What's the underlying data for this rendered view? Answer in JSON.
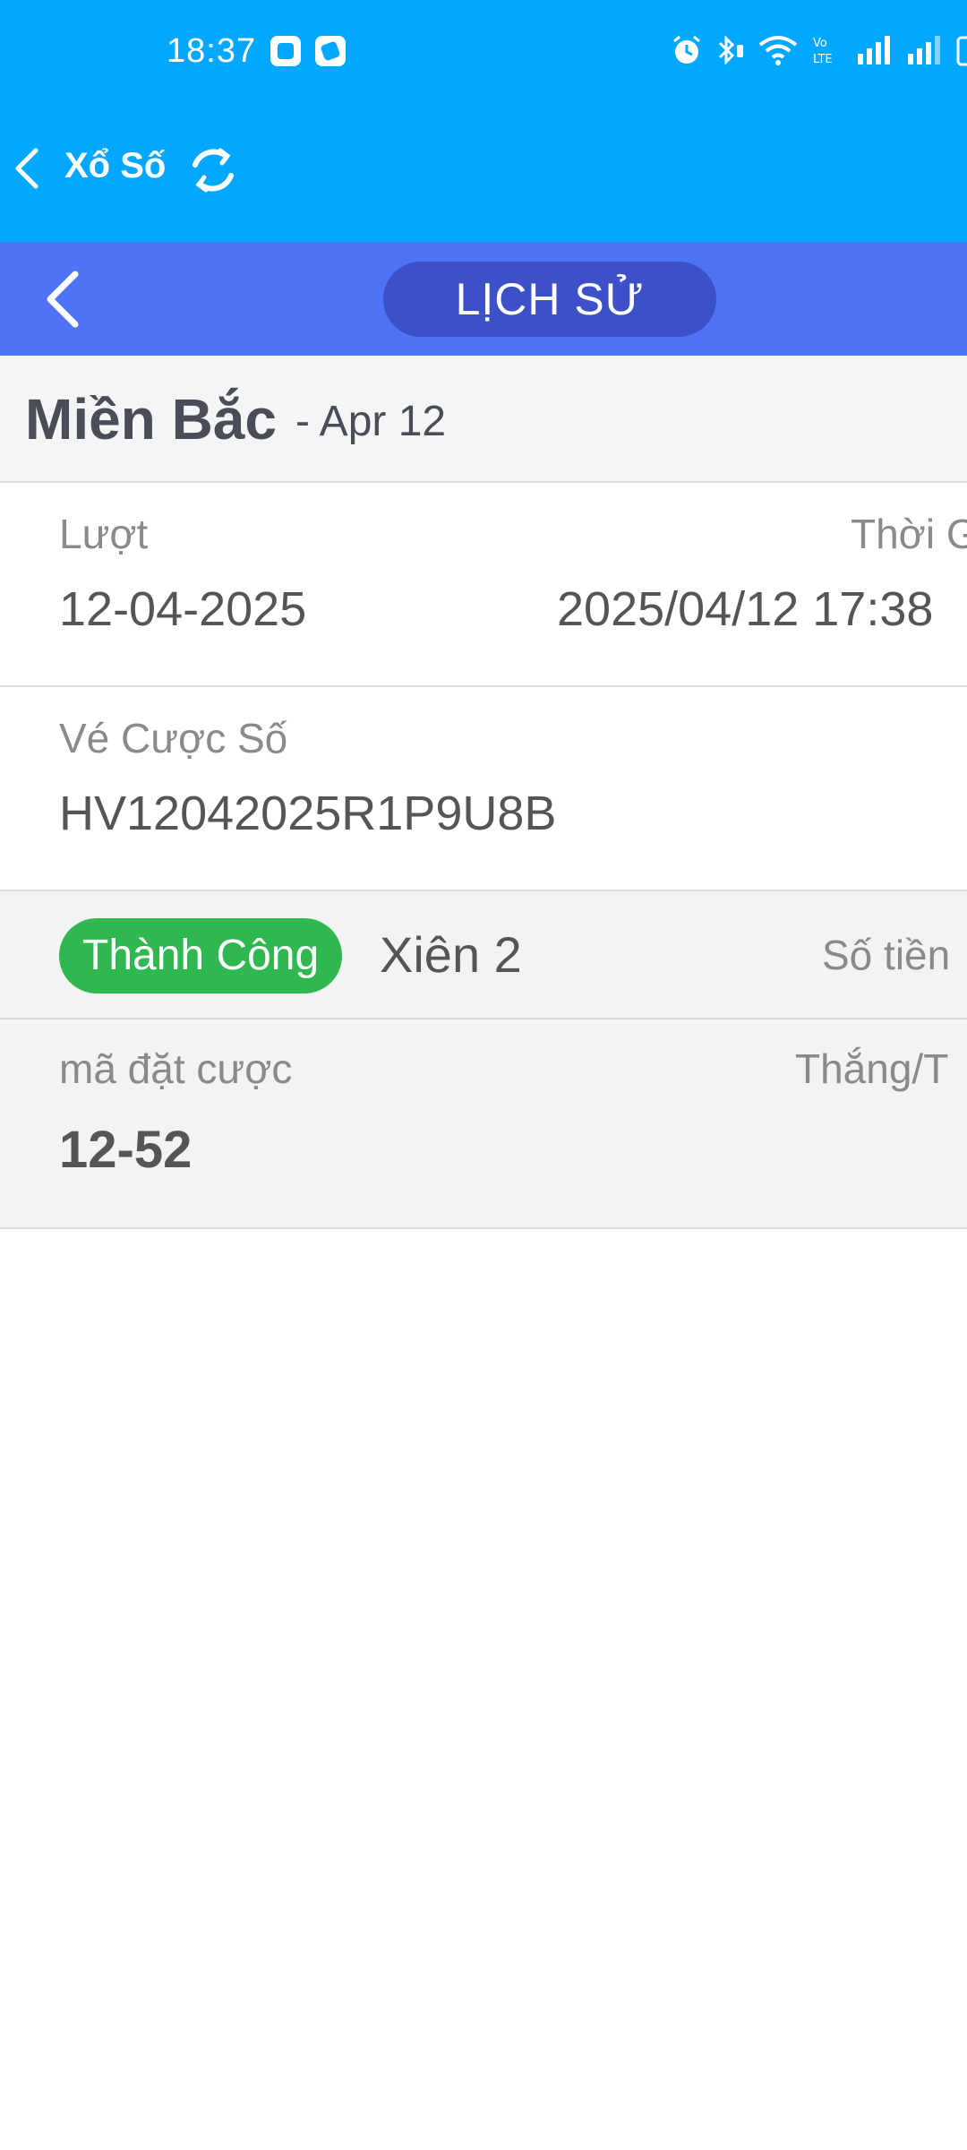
{
  "status_bar": {
    "time": "18:37",
    "icons": [
      "app-notification-icon",
      "app-notification-icon",
      "alarm-icon",
      "bluetooth-icon",
      "wifi-icon",
      "volte-icon",
      "signal-icon",
      "signal-icon",
      "battery-icon"
    ]
  },
  "app_bar": {
    "title": "Xổ Số",
    "back_icon": "chevron-left-icon",
    "refresh_icon": "refresh-icon"
  },
  "sub_bar": {
    "title": "LỊCH SỬ",
    "back_icon": "chevron-left-icon"
  },
  "section": {
    "region": "Miền Bắc",
    "date": "- Apr 12"
  },
  "detail": {
    "round_label": "Lượt",
    "round_value": "12-04-2025",
    "time_label": "Thời G",
    "time_value": "2025/04/12 17:38",
    "ticket_label": "Vé Cược Số",
    "ticket_value": "HV12042025R1P9U8B",
    "status": "Thành Công",
    "bet_type": "Xiên 2",
    "amount_label": "Số tiền",
    "code_label": "mã đặt cược",
    "code_value": "12-52",
    "win_label": "Thắng/T"
  },
  "colors": {
    "app_bar": "#02a7ff",
    "sub_bar": "#4f73f6",
    "pill": "#3c51c7",
    "success": "#2fb84f"
  }
}
